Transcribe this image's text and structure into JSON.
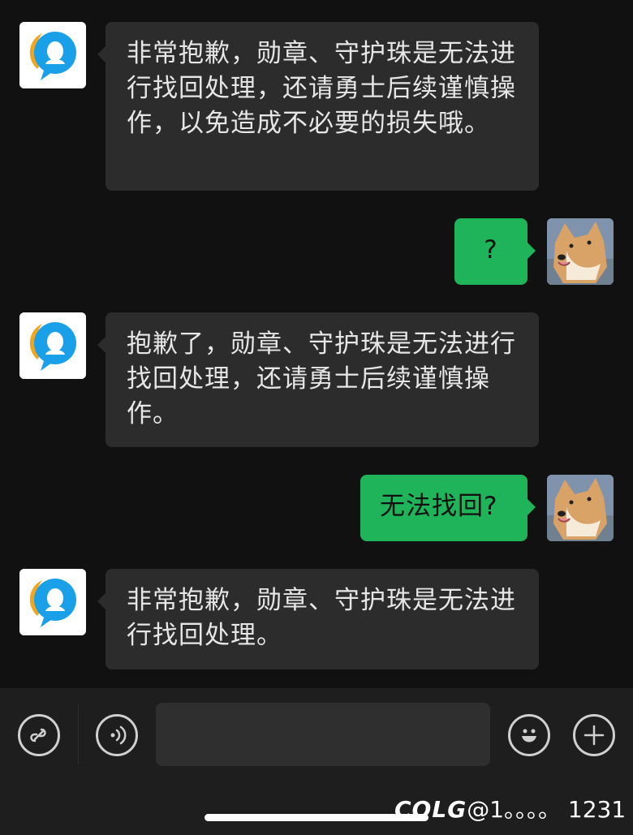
{
  "messages": [
    {
      "sender": "bot",
      "avatar": "customer-service-avatar",
      "text": "非常抱歉，勋章、守护珠是无法进行找回处理，还请勇士后续谨慎操作，以免造成不必要的损失哦。"
    },
    {
      "sender": "user",
      "avatar": "shiba-dog-avatar",
      "text": "?"
    },
    {
      "sender": "bot",
      "avatar": "customer-service-avatar",
      "text": "抱歉了，勋章、守护珠是无法进行找回处理，还请勇士后续谨慎操作。"
    },
    {
      "sender": "user",
      "avatar": "shiba-dog-avatar",
      "text": "无法找回?"
    },
    {
      "sender": "bot",
      "avatar": "customer-service-avatar",
      "text": "非常抱歉，勋章、守护珠是无法进行找回处理。"
    }
  ],
  "toolbar": {
    "input_value": "",
    "icons": [
      "mini-program-icon",
      "voice-icon",
      "emoji-icon",
      "plus-icon"
    ]
  },
  "watermark": {
    "logo": "COLG",
    "handle": "@1。。。。 1231"
  },
  "colors": {
    "background": "#111111",
    "bot_bubble": "#2c2c2c",
    "user_bubble": "#1fb35a",
    "toolbar": "#1e1e1e"
  }
}
